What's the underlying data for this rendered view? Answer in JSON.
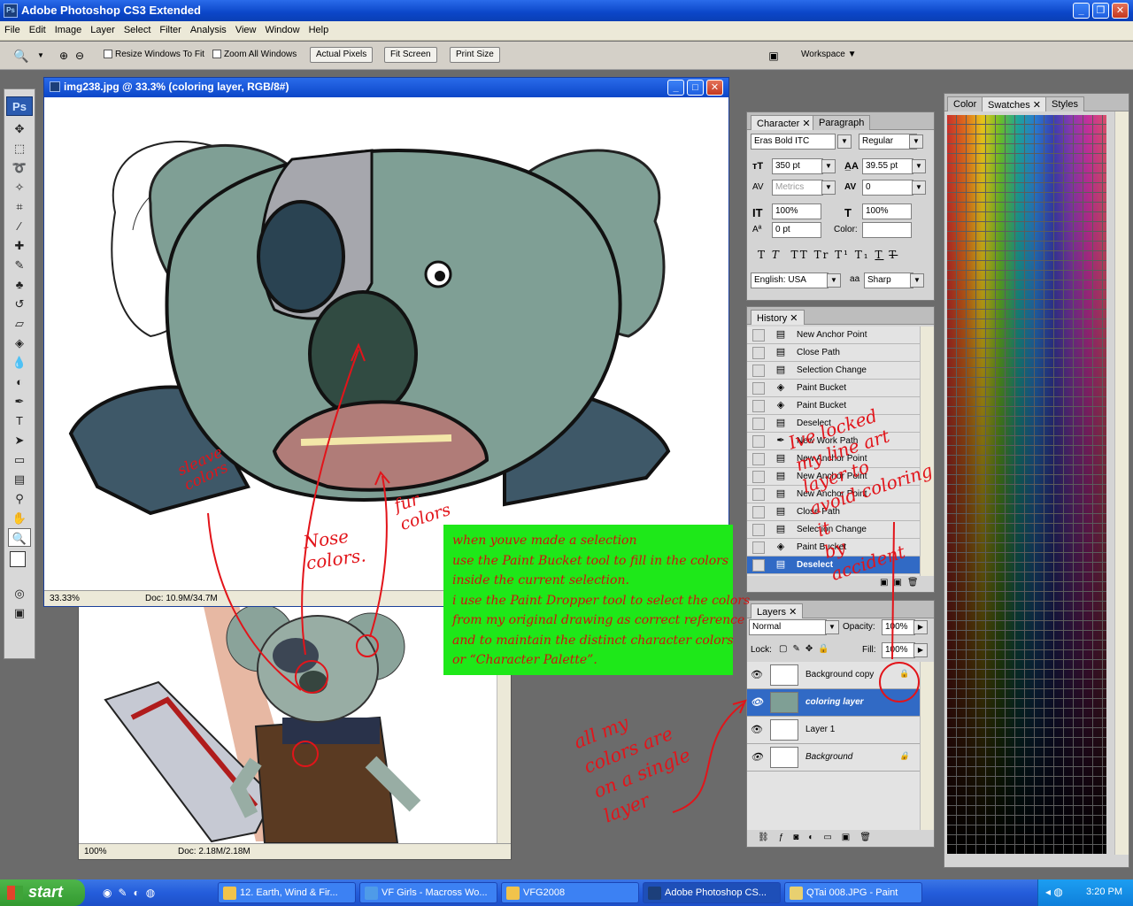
{
  "window": {
    "title": "Adobe Photoshop CS3 Extended",
    "logo": "Ps"
  },
  "menu": [
    "File",
    "Edit",
    "Image",
    "Layer",
    "Select",
    "Filter",
    "Analysis",
    "View",
    "Window",
    "Help"
  ],
  "options": {
    "resize_windows": "Resize Windows To Fit",
    "zoom_all": "Zoom All Windows",
    "actual_pixels": "Actual Pixels",
    "fit_screen": "Fit Screen",
    "print_size": "Print Size",
    "workspace": "Workspace"
  },
  "toolbox": {
    "logo": "Ps"
  },
  "doc1": {
    "title": "img238.jpg @ 33.3% (coloring layer, RGB/8#)",
    "zoom": "33.33%",
    "doc_size": "Doc: 10.9M/34.7M"
  },
  "doc2": {
    "zoom": "100%",
    "doc_size": "Doc: 2.18M/2.18M"
  },
  "character": {
    "tabs": [
      "Character",
      "Paragraph"
    ],
    "font_family": "Eras Bold ITC",
    "font_style": "Regular",
    "font_size": "350 pt",
    "leading": "39.55 pt",
    "kerning": "Metrics",
    "tracking": "0",
    "vscale": "100%",
    "hscale": "100%",
    "baseline": "0 pt",
    "color_label": "Color:",
    "language": "English: USA",
    "aa_label": "a",
    "antialias": "Sharp",
    "styles": [
      "T",
      "T",
      "TT",
      "Tr",
      "T¹",
      "T₁",
      "T",
      "T"
    ]
  },
  "history": {
    "tab": "History",
    "items": [
      "New Anchor Point",
      "Close Path",
      "Selection Change",
      "Paint Bucket",
      "Paint Bucket",
      "Deselect",
      "New Work Path",
      "New Anchor Point",
      "New Anchor Point",
      "New Anchor Point",
      "Close Path",
      "Selection Change",
      "Paint Bucket",
      "Deselect"
    ],
    "selected_index": 13
  },
  "layers": {
    "tab": "Layers",
    "blend_mode": "Normal",
    "opacity_label": "Opacity:",
    "opacity": "100%",
    "lock_label": "Lock:",
    "fill_label": "Fill:",
    "fill": "100%",
    "items": [
      {
        "name": "Background copy",
        "locked": true
      },
      {
        "name": "coloring layer",
        "selected": true
      },
      {
        "name": "Layer 1"
      },
      {
        "name": "Background",
        "locked": true
      }
    ]
  },
  "swatches": {
    "tabs": [
      "Color",
      "Swatches",
      "Styles"
    ]
  },
  "taskbar": {
    "start": "start",
    "tasks": [
      "12. Earth, Wind & Fir...",
      "VF Girls - Macross Wo...",
      "VFG2008",
      "Adobe Photoshop CS...",
      "QTai 008.JPG - Paint"
    ],
    "clock": "3:20 PM"
  },
  "annotations": {
    "green_box": [
      "when youve made a selection",
      "use the Paint Bucket tool to fill in the colors",
      "inside the current selection.",
      "i use the Paint Dropper tool to select the colors",
      "from my original drawing as correct reference",
      "and to maintain the distinct character colors",
      "or “Character Palette”."
    ],
    "sleeve": "sleave\ncolors",
    "nose": "Nose\ncolors.",
    "fur": "fur\ncolors",
    "locked": "Ive locked\nmy line art\nlayer to\navoid coloring\nit\nby\naccident",
    "single_layer": "all my\ncolors are\non a single\nlayer"
  },
  "colors": {
    "accent": "#316ac5",
    "title_blue": "#0b46c8",
    "annotation_red": "#e2141a",
    "note_green": "#1ee819"
  }
}
